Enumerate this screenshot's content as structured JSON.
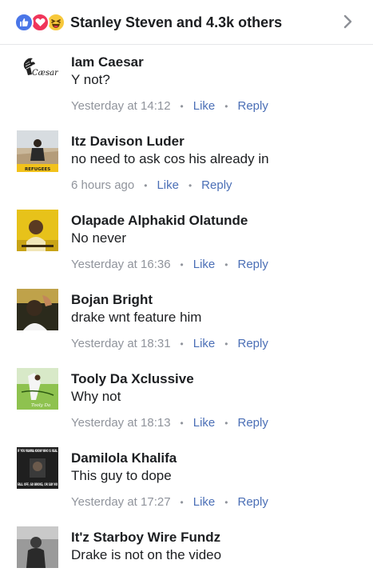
{
  "reactions": {
    "types": [
      "like",
      "love",
      "haha"
    ],
    "summary": "Stanley Steven and 4.3k others"
  },
  "colors": {
    "like_blue": "#4a76e8",
    "love_red": "#f0355a",
    "haha_yellow": "#f7c83b",
    "link_blue": "#4b6fb6",
    "meta_gray": "#90949c"
  },
  "actions": {
    "like_label": "Like",
    "reply_label": "Reply"
  },
  "comments": [
    {
      "name": "Iam Caesar",
      "text": "Y not?",
      "time": "Yesterday at 14:12",
      "avatar": {
        "caption": "Cæsar"
      }
    },
    {
      "name": "Itz Davison Luder",
      "text": "no need to ask cos his already in",
      "time": "6 hours ago",
      "avatar": {
        "caption": "REFUGEES"
      }
    },
    {
      "name": "Olapade Alphakid Olatunde",
      "text": "No never",
      "time": "Yesterday at 16:36",
      "avatar": {}
    },
    {
      "name": "Bojan Bright",
      "text": "drake wnt feature him",
      "time": "Yesterday at 18:31",
      "avatar": {}
    },
    {
      "name": "Tooly Da Xclussive",
      "text": "Why not",
      "time": "Yesterday at 18:13",
      "avatar": {
        "caption": "Tooly Da"
      }
    },
    {
      "name": "Damilola Khalifa",
      "text": "This guy to dope",
      "time": "Yesterday at 17:27",
      "avatar": {
        "caption_top": "IF YOU WANNA KNOW WHO IS REAL",
        "caption_bottom": "FALL OFF, GO BROKE, OR SAY NO"
      }
    },
    {
      "name": "It'z Starboy Wire Fundz",
      "text": "Drake is not on the video",
      "avatar": {}
    }
  ]
}
